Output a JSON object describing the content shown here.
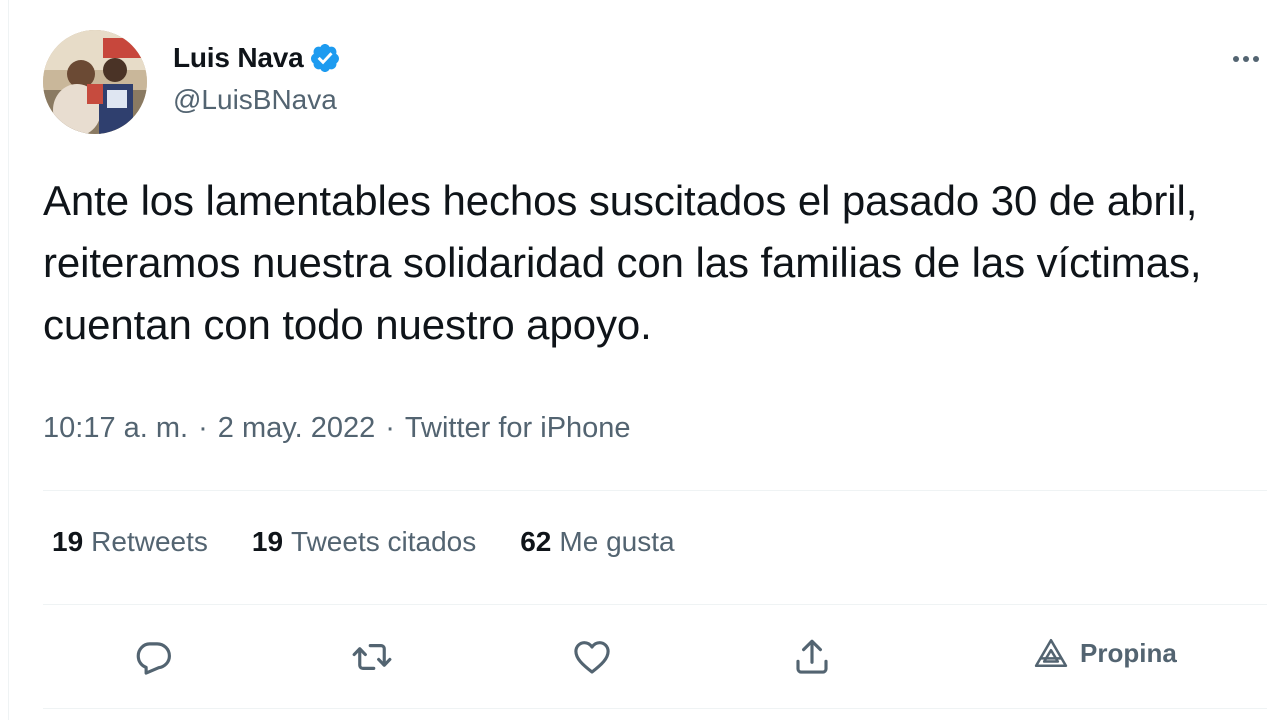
{
  "tweet": {
    "author": {
      "display_name": "Luis Nava",
      "handle": "@LuisBNava",
      "verified": true,
      "verified_color": "#1d9bf0"
    },
    "text": "Ante los lamentables hechos suscitados el pasado 30 de abril, reiteramos nuestra solidaridad con las familias de las víctimas, cuentan con todo nuestro apoyo.",
    "time": "10:17 a. m.",
    "date": "2 may. 2022",
    "source": "Twitter for iPhone",
    "separator": "·",
    "stats": [
      {
        "count": "19",
        "label": "Retweets"
      },
      {
        "count": "19",
        "label": "Tweets citados"
      },
      {
        "count": "62",
        "label": "Me gusta"
      }
    ],
    "actions": {
      "reply_icon": "reply-icon",
      "retweet_icon": "retweet-icon",
      "like_icon": "heart-icon",
      "share_icon": "share-icon",
      "promote_icon": "promote-icon",
      "promote_label": "Propina",
      "more_icon": "more-icon"
    }
  },
  "colors": {
    "text_primary": "#0f1419",
    "text_secondary": "#536471",
    "divider": "#eff3f4",
    "accent": "#1d9bf0"
  }
}
